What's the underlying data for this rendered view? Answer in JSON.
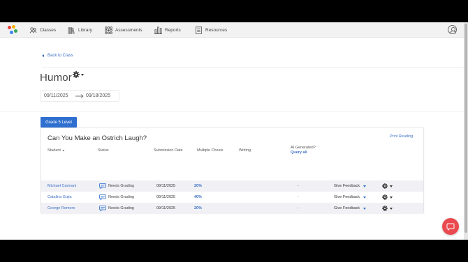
{
  "nav": {
    "items": [
      {
        "label": "Classes",
        "icon": "classes-icon"
      },
      {
        "label": "Library",
        "icon": "library-icon"
      },
      {
        "label": "Assessments",
        "icon": "assessments-icon"
      },
      {
        "label": "Reports",
        "icon": "reports-icon"
      },
      {
        "label": "Resources",
        "icon": "resources-icon"
      }
    ]
  },
  "back_link": "Back to Class",
  "page_title": "Humor",
  "date_range": {
    "start": "09/11/2025",
    "end": "09/18/2025"
  },
  "level_tab": "Grade 5 Level",
  "card": {
    "title": "Can You Make an Ostrich Laugh?",
    "print_link": "Print Reading",
    "headers": {
      "student": "Student",
      "status": "Status",
      "submission_date": "Submission Date",
      "multiple_choice": "Multiple Choice",
      "writing": "Writing",
      "ai_generated": "AI Generated?",
      "query_all": "Query all"
    },
    "rows": [
      {
        "name": "Michael Carmani",
        "status": "Needs Grading",
        "date": "09/11/2025",
        "mc": "20%",
        "ai": "-",
        "feedback": "Give Feedback"
      },
      {
        "name": "Catalina Gujia",
        "status": "Needs Grading",
        "date": "09/11/2025",
        "mc": "40%",
        "ai": "-",
        "feedback": "Give Feedback"
      },
      {
        "name": "George Romero",
        "status": "Needs Grading",
        "date": "09/11/2025",
        "mc": "20%",
        "ai": "-",
        "feedback": "Give Feedback"
      }
    ]
  },
  "colors": {
    "accent": "#2f6fcf",
    "link": "#3b6fc2",
    "chat_fab": "#ea4a4f"
  }
}
